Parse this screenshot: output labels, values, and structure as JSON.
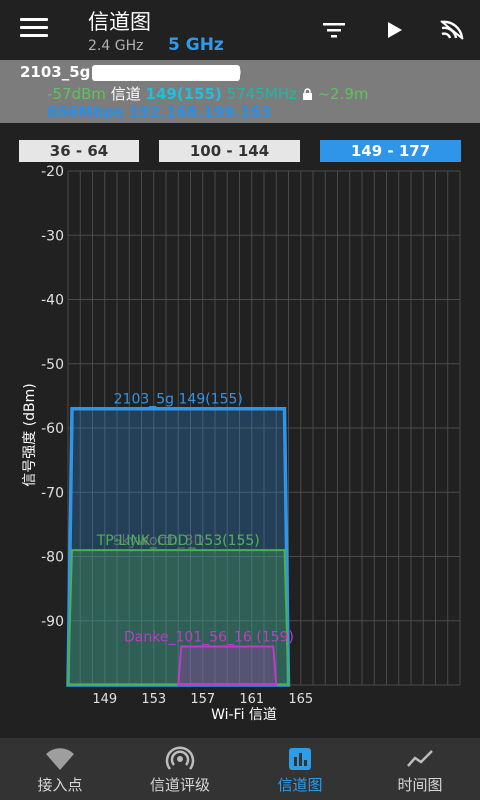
{
  "header": {
    "title": "信道图",
    "band_24": "2.4 GHz",
    "band_5": "5 GHz",
    "icons": [
      "menu-icon",
      "filter-icon",
      "play-icon",
      "wifi-scan-icon"
    ]
  },
  "connection": {
    "ssid": "2103_5g",
    "ssid_paren_open": "(",
    "ssid_paren_close": ")",
    "signal": "-57dBm",
    "channel_label": "信道",
    "channel": "149(155)",
    "frequency": "5745MHz",
    "distance": "~2.9m",
    "speed": "866Mbps",
    "ip": "192.168.199.163"
  },
  "range_tabs": [
    {
      "label": "36 - 64",
      "active": false
    },
    {
      "label": "100 - 144",
      "active": false
    },
    {
      "label": "149 - 177",
      "active": true
    }
  ],
  "chart_data": {
    "type": "area",
    "ylabel": "信号强度 (dBm)",
    "xlabel": "Wi-Fi 信道",
    "y_ticks": [
      "-20",
      "-30",
      "-40",
      "-50",
      "-60",
      "-70",
      "-80",
      "-90"
    ],
    "ylim": [
      -100,
      -20
    ],
    "x_ticks": [
      "149",
      "153",
      "157",
      "161",
      "165"
    ],
    "xlim": [
      146,
      178
    ],
    "grid": true,
    "networks": [
      {
        "label": "2103_5g 149(155)",
        "from": 146,
        "to": 164,
        "signal": -57,
        "color": "#2f95e8"
      },
      {
        "label": "TP-LINK_CDD_153(155)",
        "ghost_label": "Skyworth_3D53(155)",
        "from": 146,
        "to": 164,
        "signal": -79,
        "color": "#4caf50"
      },
      {
        "label": "Danke_101_56_16 (159)",
        "from": 155,
        "to": 163,
        "signal": -94,
        "color": "#c03ac9"
      }
    ]
  },
  "nav": [
    {
      "label": "接入点",
      "icon": "wifi-icon",
      "active": false
    },
    {
      "label": "信道评级",
      "icon": "signal-rating-icon",
      "active": false
    },
    {
      "label": "信道图",
      "icon": "bar-chart-icon",
      "active": true
    },
    {
      "label": "时间图",
      "icon": "line-chart-icon",
      "active": false
    }
  ]
}
